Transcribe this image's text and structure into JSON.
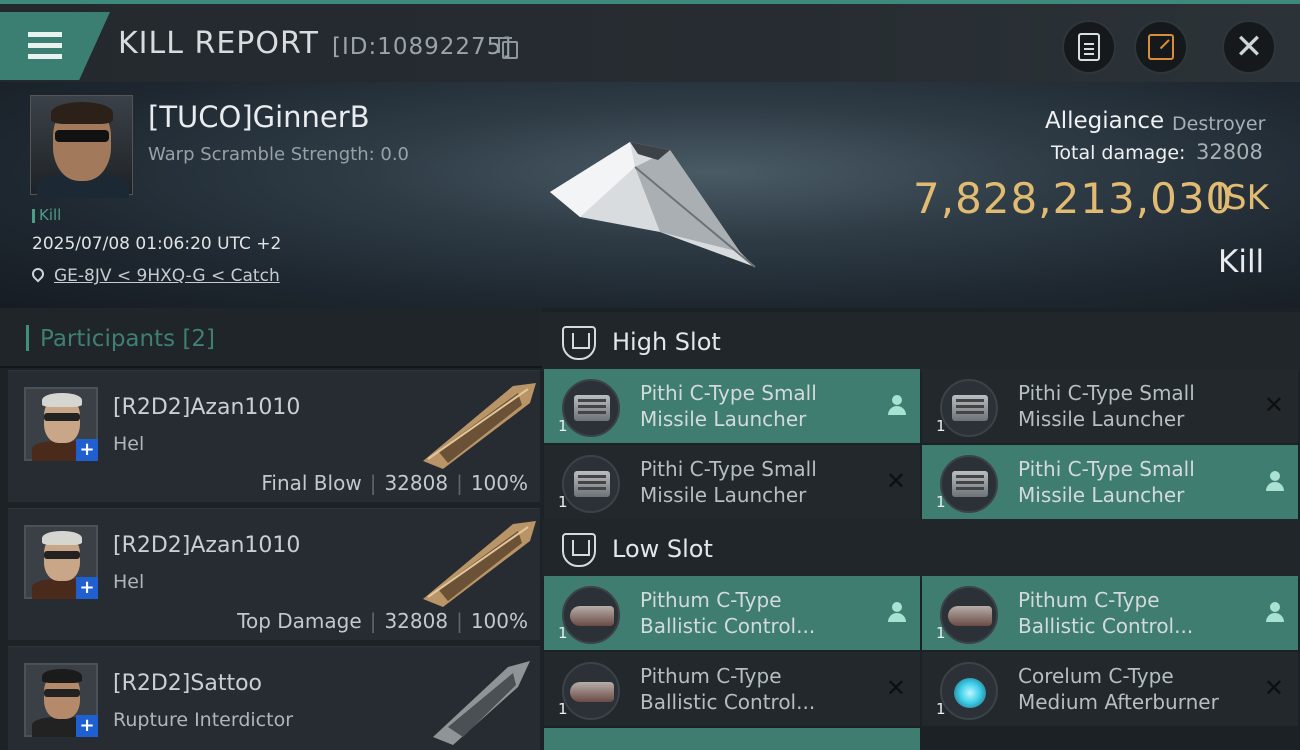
{
  "header": {
    "title": "KILL REPORT",
    "kill_id": "[ID:10892275]"
  },
  "victim": {
    "name": "[TUCO]GinnerB",
    "warp_scramble": "Warp Scramble Strength: 0.0",
    "kill_tag": "Kill",
    "datetime": "2025/07/08 01:06:20 UTC +2",
    "location": "GE-8JV < 9HXQ-G < Catch",
    "allegiance_label": "Allegiance",
    "allegiance_value": "Destroyer",
    "total_damage_label": "Total damage:",
    "total_damage_value": "32808",
    "isk_value": "7,828,213,030",
    "isk_unit": "ISK",
    "result": "Kill"
  },
  "participants": {
    "title": "Participants",
    "count": "[2]",
    "items": [
      {
        "name": "[R2D2]Azan1010",
        "ship": "Hel",
        "role": "Final Blow",
        "damage": "32808",
        "percent": "100%"
      },
      {
        "name": "[R2D2]Azan1010",
        "ship": "Hel",
        "role": "Top Damage",
        "damage": "32808",
        "percent": "100%"
      },
      {
        "name": "[R2D2]Sattoo",
        "ship": "Rupture Interdictor"
      }
    ]
  },
  "slots": {
    "high": {
      "title": "High Slot",
      "items": [
        {
          "line1": "Pithi C-Type Small",
          "line2": "Missile Launcher",
          "qty": "1"
        },
        {
          "line1": "Pithi C-Type Small",
          "line2": "Missile Launcher",
          "qty": "1"
        },
        {
          "line1": "Pithi C-Type Small",
          "line2": "Missile Launcher",
          "qty": "1"
        },
        {
          "line1": "Pithi C-Type Small",
          "line2": "Missile Launcher",
          "qty": "1"
        }
      ]
    },
    "low": {
      "title": "Low Slot",
      "items": [
        {
          "line1": "Pithum C-Type",
          "line2": "Ballistic Control...",
          "qty": "1"
        },
        {
          "line1": "Pithum C-Type",
          "line2": "Ballistic Control...",
          "qty": "1"
        },
        {
          "line1": "Pithum C-Type",
          "line2": "Ballistic Control...",
          "qty": "1"
        },
        {
          "line1": "Corelum C-Type",
          "line2": "Medium Afterburner",
          "qty": "1"
        }
      ]
    }
  },
  "colors": {
    "accent": "#3f7d70",
    "isk": "#e2bb73",
    "active_item": "#3f7d70"
  }
}
